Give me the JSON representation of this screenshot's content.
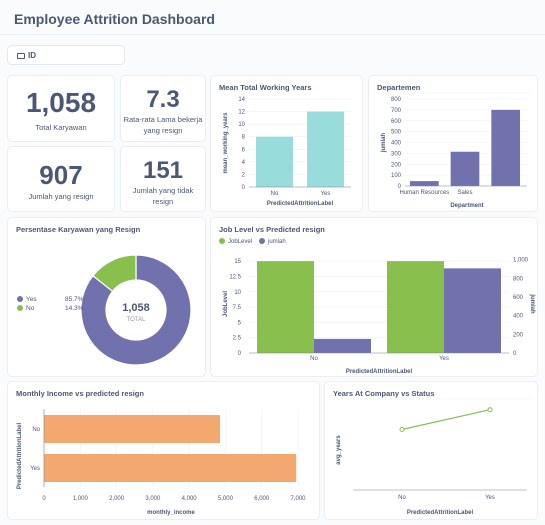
{
  "header": {
    "title": "Employee Attrition Dashboard"
  },
  "filter": {
    "label": "ID"
  },
  "kpis": {
    "total_karyawan": {
      "value": "1,058",
      "label": "Total Karyawan"
    },
    "rata_rata": {
      "value": "7.3",
      "label_line1": "Rata-rata Lama bekerja",
      "label_line2": "yang resign"
    },
    "jumlah_resign": {
      "value": "907",
      "label": "Jumlah yang resign"
    },
    "jumlah_tidak": {
      "value": "151",
      "label_line1": "Jumlah yang tidak",
      "label_line2": "resign"
    }
  },
  "colors": {
    "teal": "#98dcdc",
    "purple": "#7172ad",
    "green": "#88bf4d",
    "orange": "#f2a86f"
  },
  "chart_data": [
    {
      "id": "mean_working_years",
      "type": "bar",
      "title": "Mean Total Working Years",
      "xlabel": "PredictedAttritionLabel",
      "ylabel": "mean_working_years",
      "categories": [
        "No",
        "Yes"
      ],
      "values": [
        8,
        12
      ],
      "ylim": [
        0,
        14
      ],
      "yticks": [
        "0",
        "2",
        "4",
        "6",
        "8",
        "10",
        "12",
        "14"
      ]
    },
    {
      "id": "departemen",
      "type": "bar",
      "title": "Departemen",
      "xlabel": "Department",
      "ylabel": "jumlah",
      "categories": [
        "Human Resources",
        "Sales",
        ""
      ],
      "values": [
        45,
        315,
        700
      ],
      "ylim": [
        0,
        800
      ],
      "yticks": [
        "0",
        "100",
        "200",
        "300",
        "400",
        "500",
        "600",
        "700",
        "800"
      ]
    },
    {
      "id": "persentase",
      "type": "pie",
      "title": "Persentase Karyawan yang Resign",
      "center_value": "1,058",
      "center_label": "TOTAL",
      "slices": [
        {
          "name": "Yes",
          "pct": "85.7%",
          "value": 85.7,
          "color": "#7172ad"
        },
        {
          "name": "No",
          "pct": "14.3%",
          "value": 14.3,
          "color": "#88bf4d"
        }
      ]
    },
    {
      "id": "job_level",
      "type": "bar",
      "title": "Job Level vs Predicted resign",
      "xlabel": "PredictedAttritionLabel",
      "ylabel": "JobLevel",
      "y2label": "jumlah",
      "categories": [
        "No",
        "Yes"
      ],
      "series": [
        {
          "name": "JobLevel",
          "values": [
            15,
            15
          ],
          "color": "#88bf4d"
        },
        {
          "name": "jumlah",
          "values": [
            151,
            907
          ],
          "color": "#7172ad"
        }
      ],
      "ylim": [
        0,
        16
      ],
      "y2lim": [
        0,
        1050
      ],
      "yticks": [
        "0",
        "2.5",
        "5",
        "7.5",
        "10",
        "12.5",
        "15"
      ],
      "y2ticks": [
        "0",
        "200",
        "400",
        "600",
        "800",
        "1,000"
      ]
    },
    {
      "id": "monthly_income",
      "type": "bar",
      "title": "Monthly Income vs predicted resign",
      "xlabel": "monthly_income",
      "ylabel": "PredictedAttritionLabel",
      "categories": [
        "No",
        "Yes"
      ],
      "values": [
        4850,
        6950
      ],
      "xlim": [
        0,
        7000
      ],
      "xticks": [
        "0",
        "1,000",
        "2,000",
        "3,000",
        "4,000",
        "5,000",
        "6,000",
        "7,000"
      ]
    },
    {
      "id": "years_at_company",
      "type": "line",
      "title": "Years At Company vs Status",
      "xlabel": "PredictedAttritionLabel",
      "ylabel": "avg_years",
      "categories": [
        "No",
        "Yes"
      ],
      "values": [
        5.5,
        7.3
      ],
      "ylim": [
        0,
        8
      ]
    }
  ]
}
